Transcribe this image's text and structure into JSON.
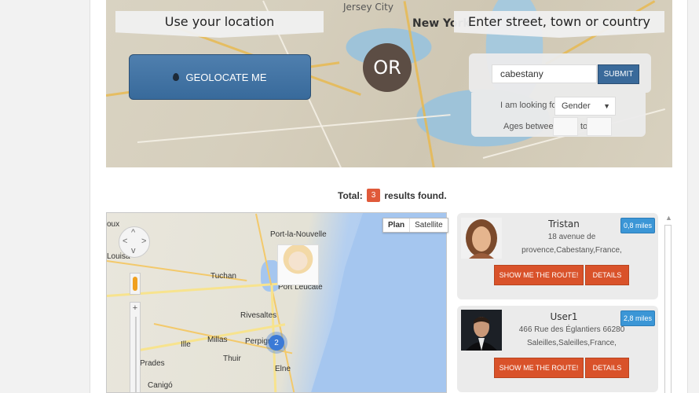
{
  "hero": {
    "left_title": "Use your location",
    "right_title": "Enter street, town or country",
    "geolocate_label": "GEOLOCATE ME",
    "or_label": "OR",
    "map_labels": [
      "Jersey City",
      "New York"
    ],
    "search": {
      "value": "cabestany",
      "submit_label": "SUBMIT"
    },
    "filters": {
      "looking_for_label": "I am looking for",
      "gender_value": "Gender",
      "ages_label": "Ages between",
      "to_label": "to"
    }
  },
  "results": {
    "total_label": "Total:",
    "count": "3",
    "found_label": "results found."
  },
  "map": {
    "type_plan": "Plan",
    "type_satellite": "Satellite",
    "cluster_count": "2",
    "towns": [
      "Port-la-Nouvelle",
      "Tuchan",
      "Port Leucate",
      "Rivesaltes",
      "Millas",
      "Perpignan",
      "Thuir",
      "Elne",
      "Prades",
      "Ille",
      "Canigó",
      "Louisa",
      "oux"
    ]
  },
  "cards": [
    {
      "name": "Tristan",
      "address_line1": "18 avenue de",
      "address_line2": "provence,Cabestany,France,",
      "distance": "0,8 miles",
      "route_label": "SHOW ME THE ROUTE!",
      "details_label": "DETAILS"
    },
    {
      "name": "User1",
      "address_line1": "466 Rue des Églantiers 66280",
      "address_line2": "Saleilles,Saleilles,France,",
      "distance": "2,8 miles",
      "route_label": "SHOW ME THE ROUTE!",
      "details_label": "DETAILS"
    }
  ],
  "colors": {
    "accent_blue": "#386a9b",
    "accent_orange": "#d9522a",
    "badge_blue": "#3b96d6"
  }
}
